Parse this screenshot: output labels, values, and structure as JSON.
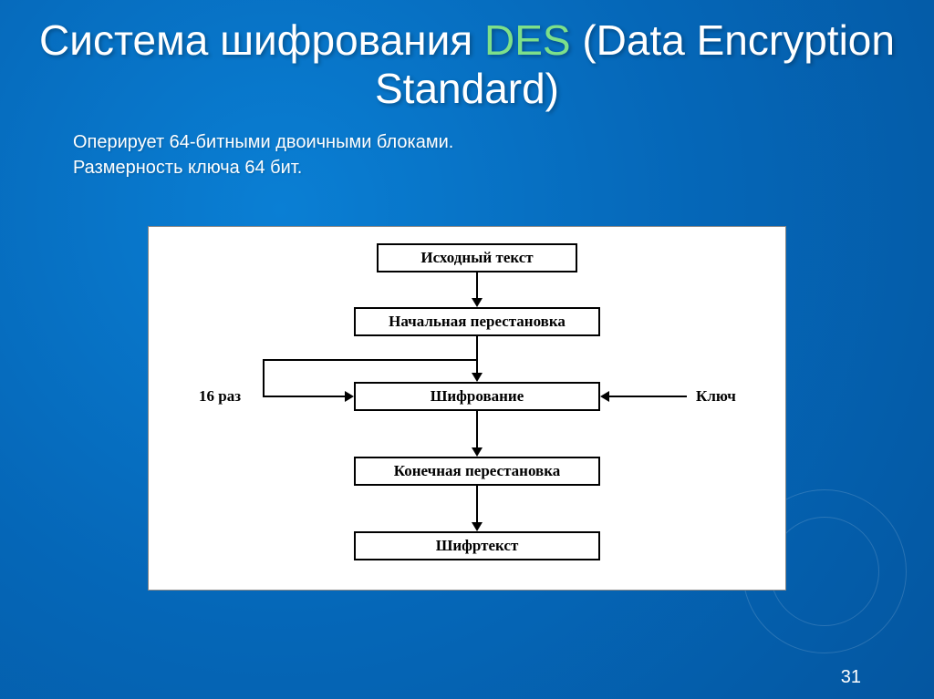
{
  "title": {
    "part1": "Система шифрования ",
    "accent": "DES",
    "part2": " (Data Encryption Standard)"
  },
  "subtitle": {
    "line1": "Оперирует 64-битными двоичными блоками.",
    "line2": "Размерность ключа 64 бит."
  },
  "diagram": {
    "boxes": {
      "b1": "Исходный текст",
      "b2": "Начальная перестановка",
      "b3": "Шифрование",
      "b4": "Конечная перестановка",
      "b5": "Шифртекст"
    },
    "labels": {
      "left": "16 раз",
      "right": "Ключ"
    }
  },
  "page_number": "31"
}
